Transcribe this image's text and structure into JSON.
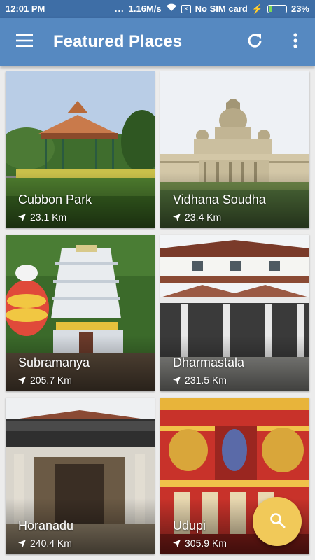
{
  "status_bar": {
    "time": "12:01 PM",
    "network_speed": "1.16M/s",
    "sim_text": "No SIM card",
    "battery_percent": "23%",
    "battery_level": 0.23
  },
  "app_bar": {
    "title": "Featured Places",
    "menu_icon": "hamburger-menu-icon",
    "refresh_icon": "refresh-icon",
    "more_icon": "more-vert-icon"
  },
  "places": [
    {
      "name": "Cubbon Park",
      "distance": "23.1 Km"
    },
    {
      "name": "Vidhana Soudha",
      "distance": "23.4 Km"
    },
    {
      "name": "Subramanya",
      "distance": "205.7 Km"
    },
    {
      "name": "Dharmastala",
      "distance": "231.5 Km"
    },
    {
      "name": "Horanadu",
      "distance": "240.4 Km"
    },
    {
      "name": "Udupi",
      "distance": "305.9 Km"
    }
  ],
  "fab": {
    "icon": "search-icon"
  },
  "colors": {
    "status_bar": "#3e6ea6",
    "app_bar": "#5689c1",
    "fab": "#f1c959"
  }
}
